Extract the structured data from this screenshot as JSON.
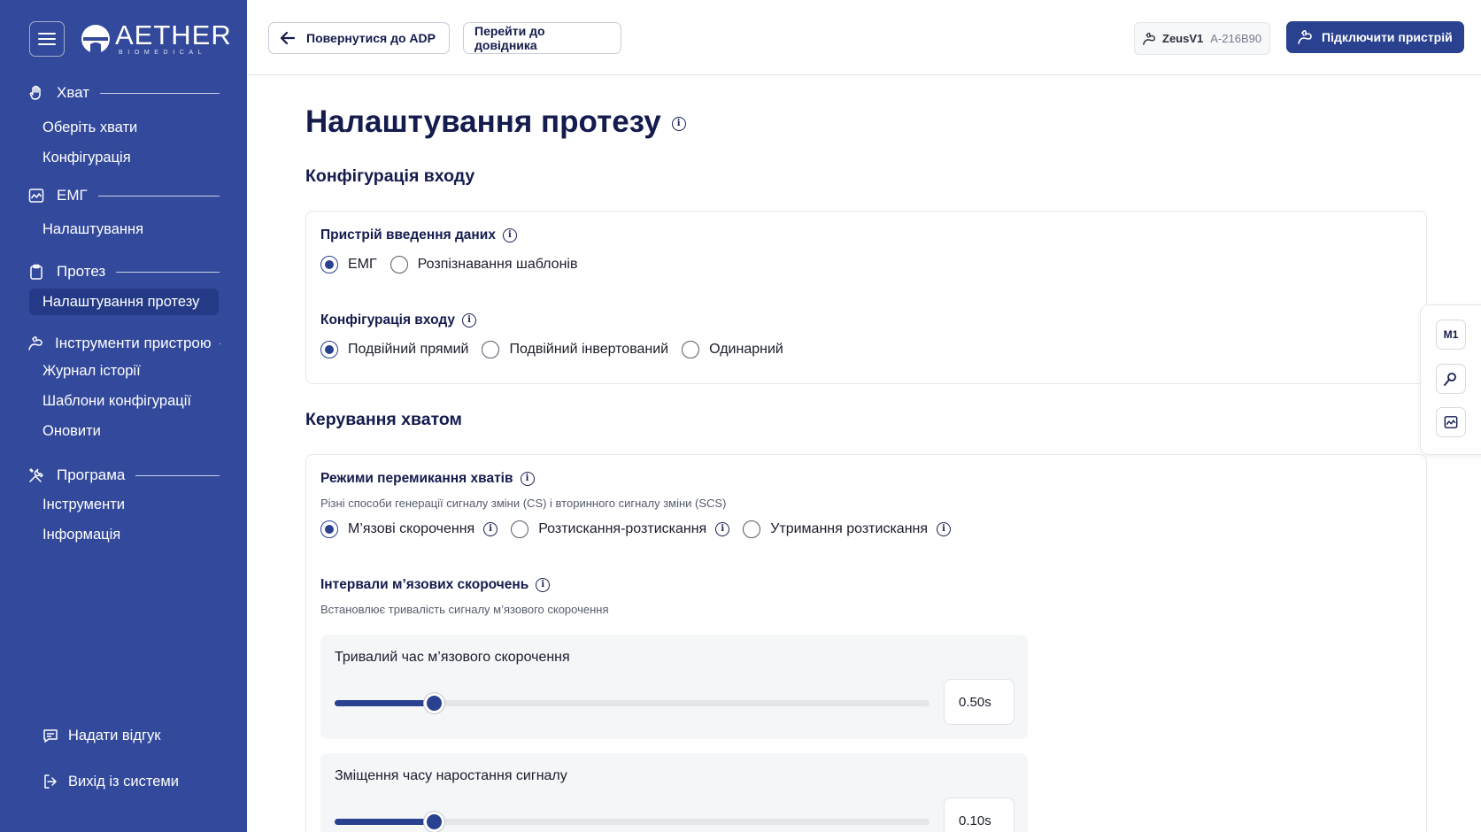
{
  "brand": {
    "name": "AETHER",
    "sub": "BIOMEDICAL"
  },
  "sidebar": {
    "sections": [
      {
        "label": "Хват",
        "icon": "hand-icon",
        "items": [
          "Оберіть хвати",
          "Конфігурація"
        ]
      },
      {
        "label": "ЕМГ",
        "icon": "chart-icon",
        "items": [
          "Налаштування"
        ]
      },
      {
        "label": "Протез",
        "icon": "clipboard-icon",
        "items": [
          "Налаштування протезу"
        ]
      },
      {
        "label": "Інструменти пристрою",
        "icon": "arm-icon",
        "items": [
          "Журнал історії",
          "Шаблони конфігурації",
          "Оновити"
        ]
      },
      {
        "label": "Програма",
        "icon": "tools-icon",
        "items": [
          "Інструменти",
          "Інформація"
        ]
      }
    ],
    "active_item": "Налаштування протезу",
    "feedback": "Надати відгук",
    "logout": "Вихід із системи"
  },
  "header": {
    "back_label": "Повернутися до ADP",
    "help_label": "Перейти до довідника",
    "device_name": "ZeusV1",
    "device_id": "A-216B90",
    "connect_label": "Підключити пристрій"
  },
  "main": {
    "title": "Налаштування протезу",
    "input_section_title": "Конфігурація входу",
    "input_device": {
      "label": "Пристрій введення даних",
      "options": [
        "ЕМГ",
        "Розпізнавання шаблонів"
      ],
      "selected": 0
    },
    "input_config": {
      "label": "Конфігурація входу",
      "options": [
        "Подвійний прямий",
        "Подвійний інвертований",
        "Одинарний"
      ],
      "selected": 0
    },
    "grip_section_title": "Керування хватом",
    "switch_modes": {
      "label": "Режими перемикання хватів",
      "desc": "Різні способи генерації сигналу зміни (CS) і вторинного сигналу зміни (SCS)",
      "options": [
        "М’язові скорочення",
        "Розтискання-розтискання",
        "Утримання розтискання"
      ],
      "selected": 0
    },
    "intervals": {
      "label": "Інтервали м’язових скорочень",
      "desc": "Встановлює тривалість сигналу м’язового скорочення"
    },
    "sliders": [
      {
        "label": "Тривалий час м’язового скорочення",
        "value": "0.50s",
        "fraction": 0.166
      },
      {
        "label": "Зміщення часу наростання сигналу",
        "value": "0.10s",
        "fraction": 0.166
      }
    ]
  },
  "float_toolbar": {
    "m1_label": "M1"
  },
  "colors": {
    "sidebar_bg": "#33499b",
    "accent": "#29418f",
    "active_item_bg": "#243a86",
    "text_dark": "#141b4d"
  }
}
